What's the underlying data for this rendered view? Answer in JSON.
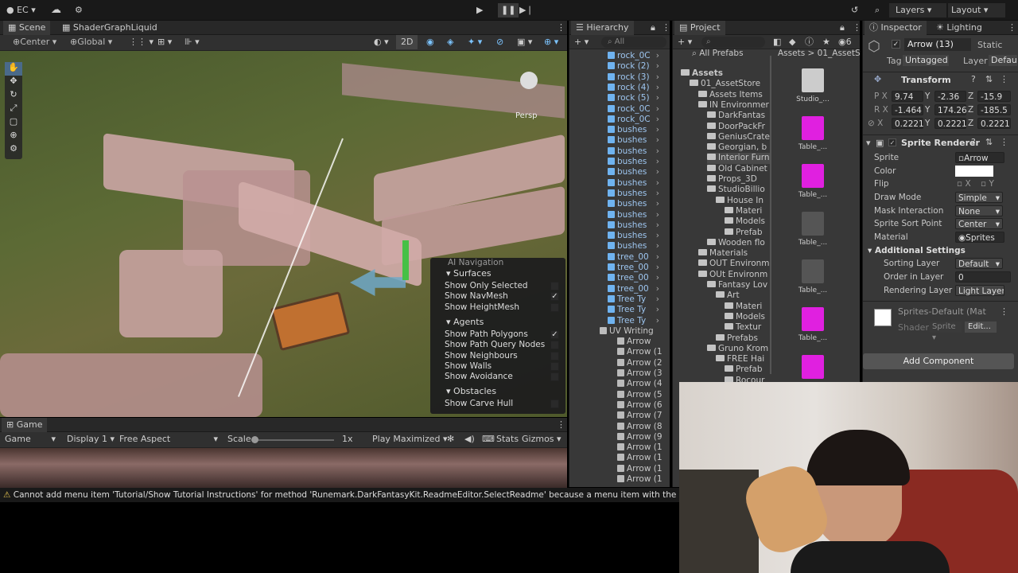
{
  "toolbar": {
    "account": "EC",
    "layers": "Layers",
    "layout": "Layout"
  },
  "scene": {
    "tab_scene": "Scene",
    "tab_graph": "ShaderGraphLiquid",
    "pivot": "Center",
    "space": "Global",
    "mode_2d": "2D",
    "persp": "Persp"
  },
  "ai_nav": {
    "title": "AI Navigation",
    "surfaces": "Surfaces",
    "items1": [
      "Show Only Selected",
      "Show NavMesh",
      "Show HeightMesh"
    ],
    "agents": "Agents",
    "items2": [
      "Show Path Polygons",
      "Show Path Query Nodes",
      "Show Neighbours",
      "Show Walls",
      "Show Avoidance"
    ],
    "obstacles": "Obstacles",
    "items3": [
      "Show Carve Hull"
    ]
  },
  "game": {
    "tab": "Game",
    "display_mode": "Game",
    "display": "Display 1",
    "aspect": "Free Aspect",
    "scale_label": "Scale",
    "scale_value": "1x",
    "play_mode": "Play Maximized",
    "stats": "Stats",
    "gizmos": "Gizmos"
  },
  "hierarchy": {
    "tab": "Hierarchy",
    "search": "All",
    "rows": [
      "rock_0C",
      "rock (2)",
      "rock (3)",
      "rock (4)",
      "rock (5)",
      "rock_0C",
      "rock_0C",
      "bushes",
      "bushes",
      "bushes",
      "bushes",
      "bushes",
      "bushes",
      "bushes",
      "bushes",
      "bushes",
      "bushes",
      "bushes",
      "bushes",
      "tree_00",
      "tree_00",
      "tree_00",
      "tree_00",
      "Tree Ty",
      "Tree Ty",
      "Tree Ty",
      "UV Writing",
      "Arrow",
      "Arrow (1",
      "Arrow (2",
      "Arrow (3",
      "Arrow (4",
      "Arrow (5",
      "Arrow (6",
      "Arrow (7",
      "Arrow (8",
      "Arrow (9",
      "Arrow (1",
      "Arrow (1",
      "Arrow (1",
      "Arrow (1"
    ]
  },
  "project": {
    "tab": "Project",
    "favorites": "All Prefabs",
    "breadcrumb": "Assets > 01_AssetSto",
    "count": "6",
    "tree": [
      "Assets",
      "01_AssetStore",
      "Assets Items",
      "IN Environmer",
      "DarkFantas",
      "DoorPackFr",
      "GeniusCrate",
      "Georgian, b",
      "Interior Furn",
      "Old Cabinet",
      "Props_3D",
      "StudioBillio",
      "House In",
      "Materi",
      "Models",
      "Prefab",
      "Wooden flo",
      "Materials",
      "OUT Environm",
      "OUt Environm",
      "Fantasy Lov",
      "Art",
      "Materi",
      "Models",
      "Textur",
      "Prefabs",
      "Gruno Krom",
      "FREE Hai",
      "Prefab",
      "Rocour"
    ],
    "assets": [
      "Studio_...",
      "Table_...",
      "Table_...",
      "Table_...",
      "Table_...",
      "Table_...",
      ""
    ]
  },
  "inspector": {
    "tab": "Inspector",
    "tab2": "Lighting",
    "name": "Arrow (13)",
    "static": "Static",
    "tag_label": "Tag",
    "tag": "Untagged",
    "layer_label": "Layer",
    "layer": "Default",
    "transform": "Transform",
    "pos": {
      "x": "9.74",
      "y": "-2.36",
      "z": "-15.9"
    },
    "rot": {
      "x": "-1.464",
      "y": "174.26",
      "z": "-185.5"
    },
    "scale": {
      "x": "0.2221",
      "y": "0.2221",
      "z": "0.2221"
    },
    "sprite_renderer": "Sprite Renderer",
    "sprite_label": "Sprite",
    "sprite": "Arrow",
    "color_label": "Color",
    "flip_label": "Flip",
    "flip_x": "X",
    "flip_y": "Y",
    "draw_label": "Draw Mode",
    "draw": "Simple",
    "mask_label": "Mask Interaction",
    "mask": "None",
    "sort_label": "Sprite Sort Point",
    "sort": "Center",
    "material_label": "Material",
    "material": "Sprites",
    "additional": "Additional Settings",
    "sorting_layer_label": "Sorting Layer",
    "sorting_layer": "Default",
    "order_label": "Order in Layer",
    "order": "0",
    "render_layer_label": "Rendering Layer M",
    "render_layer": "Light Layer",
    "mat_name": "Sprites-Default (Mat",
    "shader_label": "Shader",
    "shader": "Sprite",
    "edit": "Edit...",
    "add_component": "Add Component"
  },
  "status": {
    "message": "Cannot add menu item 'Tutorial/Show Tutorial Instructions' for method 'Runemark.DarkFantasyKit.ReadmeEditor.SelectReadme' because a menu item with the same name alre"
  }
}
